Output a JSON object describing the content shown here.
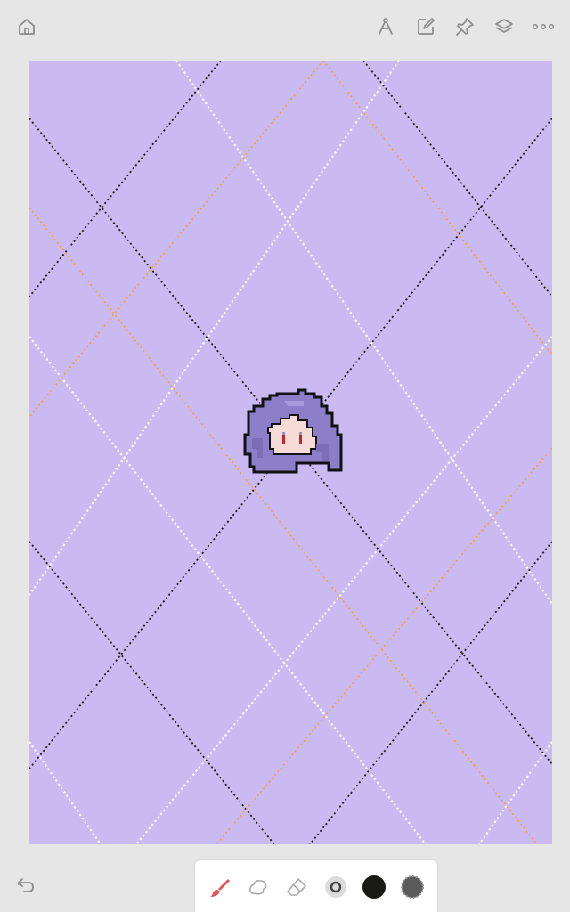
{
  "app": {
    "name": "pixel-drawing-app",
    "colors": {
      "background": "#e6e6e6",
      "canvas": "#cbbaf2",
      "icon": "#8a8a8a",
      "brush_accent": "#e05555",
      "current_color": "#1a1a14",
      "secondary_color": "#5a5a5a"
    }
  },
  "topbar": {
    "home_icon": "home-icon",
    "right_icons": [
      "ruler-compass-icon",
      "edit-square-icon",
      "pin-icon",
      "layers-icon",
      "more-icon"
    ]
  },
  "canvas": {
    "background": "#cbbaf2",
    "grid_line_colors": [
      "#1a1a1a",
      "#ffffff",
      "#f0a040"
    ],
    "sprite": "chibi-head-pixel-art"
  },
  "toolbar": {
    "tools": [
      "brush-tool",
      "smudge-tool",
      "eraser-tool",
      "brush-size",
      "current-color",
      "secondary-color"
    ]
  },
  "bottom": {
    "undo_icon": "undo-icon"
  }
}
